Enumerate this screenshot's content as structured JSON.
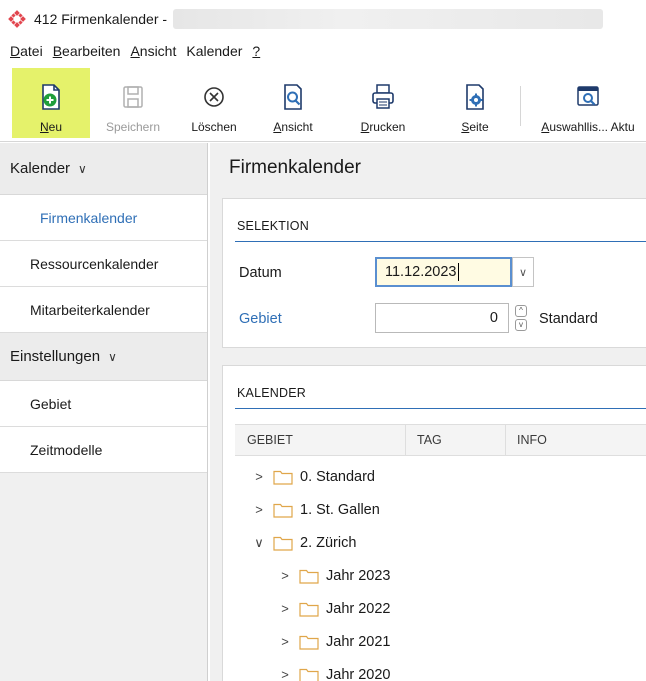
{
  "window": {
    "title": "412 Firmenkalender -"
  },
  "menu": [
    {
      "pre": "",
      "u": "D",
      "post": "atei"
    },
    {
      "pre": "",
      "u": "B",
      "post": "earbeiten"
    },
    {
      "pre": "",
      "u": "A",
      "post": "nsicht"
    },
    {
      "pre": "Kalender",
      "u": "",
      "post": ""
    },
    {
      "pre": "",
      "u": "?",
      "post": ""
    }
  ],
  "toolbar": [
    {
      "u": "N",
      "rest": "eu",
      "icon": "new-document-plus-icon",
      "state": "active"
    },
    {
      "u": "",
      "rest": "Speichern",
      "icon": "save-disk-icon",
      "state": "disabled"
    },
    {
      "u": "",
      "rest": "Löschen",
      "icon": "delete-circle-x-icon",
      "state": "normal"
    },
    {
      "u": "A",
      "rest": "nsicht",
      "icon": "preview-magnifier-icon",
      "state": "normal"
    },
    {
      "u": "D",
      "rest": "rucken",
      "icon": "printer-icon",
      "state": "normal"
    },
    {
      "u": "S",
      "rest": "eite",
      "icon": "page-settings-gear-icon",
      "state": "normal"
    },
    {
      "u": "A",
      "rest": "uswahllis... Aktu",
      "icon": "selection-list-window-icon",
      "state": "normal"
    }
  ],
  "nav": {
    "group_kalender": "Kalender",
    "items_kalender": [
      "Firmenkalender",
      "Ressourcenkalender",
      "Mitarbeiterkalender"
    ],
    "group_einstellungen": "Einstellungen",
    "items_einstellungen": [
      "Gebiet",
      "Zeitmodelle"
    ],
    "chevron": "∨"
  },
  "main": {
    "title": "Firmenkalender",
    "selektion": {
      "heading": "SELEKTION",
      "datum_label": "Datum",
      "datum_value": "11.12.2023",
      "gebiet_label": "Gebiet",
      "gebiet_value": "0",
      "gebiet_name": "Standard"
    },
    "kalender": {
      "heading": "KALENDER",
      "columns": [
        "GEBIET",
        "TAG",
        "INFO"
      ],
      "rows": [
        {
          "label": "0. Standard",
          "expanded": false,
          "level": 0
        },
        {
          "label": "1. St. Gallen",
          "expanded": false,
          "level": 0
        },
        {
          "label": "2. Zürich",
          "expanded": true,
          "level": 0
        },
        {
          "label": "Jahr 2023",
          "expanded": false,
          "level": 1
        },
        {
          "label": "Jahr 2022",
          "expanded": false,
          "level": 1
        },
        {
          "label": "Jahr 2021",
          "expanded": false,
          "level": 1
        },
        {
          "label": "Jahr 2020",
          "expanded": false,
          "level": 1
        }
      ]
    }
  },
  "colors": {
    "accent_blue": "#2f6fb6",
    "active_yellow": "#e5f26b",
    "folder_orange": "#e0a64a"
  }
}
